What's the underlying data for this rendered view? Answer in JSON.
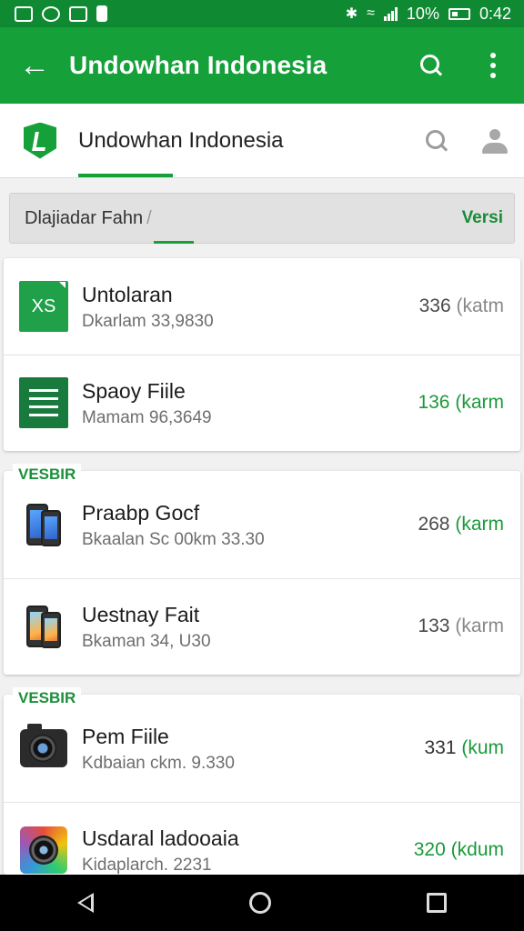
{
  "status_bar": {
    "battery_text": "10%",
    "time": "0:42",
    "icons": [
      "photo-icon",
      "whatsapp-icon",
      "image-icon",
      "sim-icon",
      "bluetooth-icon",
      "wifi-icon",
      "signal-icon",
      "battery-icon"
    ]
  },
  "app_bar": {
    "title": "Undowhan Indonesia",
    "background": "#16a03a"
  },
  "sub_header": {
    "title": "Undowhan Indonesia"
  },
  "filter_bar": {
    "label": "Dlajiadar Fahn",
    "slash": "/",
    "right": "Versi"
  },
  "sections": [
    {
      "label": "",
      "items": [
        {
          "name": "Untolaran",
          "meta": "Dkarlam 33,9830",
          "size_num": "336",
          "size_unit": "(katm",
          "icon": "excel-icon",
          "highlight": false
        },
        {
          "name": "Spaoy Fiile",
          "meta": "Mamam 96,3649",
          "size_num": "136",
          "size_unit": "(karm",
          "icon": "sheets-icon",
          "highlight": true
        }
      ]
    },
    {
      "label": "VESBIR",
      "items": [
        {
          "name": "Praabp Gocf",
          "meta": "Bkaalan Sc 00km 33.30",
          "size_num": "268",
          "size_unit": "(karm",
          "icon": "phone-icon",
          "highlight": false
        },
        {
          "name": "Uestnay Fait",
          "meta": "Bkaman 34, U30",
          "size_num": "133",
          "size_unit": "(karm",
          "icon": "phone-icon",
          "highlight": false
        }
      ]
    },
    {
      "label": "VESBIR",
      "items": [
        {
          "name": "Pem Fiile",
          "meta": "Kdbaian ckm. 9.330",
          "size_num": "331",
          "size_unit": "(kum",
          "icon": "camera-icon",
          "highlight": true
        },
        {
          "name": "Usdaral ladooaia",
          "meta": "Kidaplarch. 2231",
          "size_num": "320",
          "size_unit": "(kdum",
          "icon": "lens-icon",
          "highlight": true
        }
      ]
    }
  ],
  "colors": {
    "accent": "#16a03a",
    "status_bar": "#0f8a33",
    "highlight_text": "#1b9a3a"
  }
}
